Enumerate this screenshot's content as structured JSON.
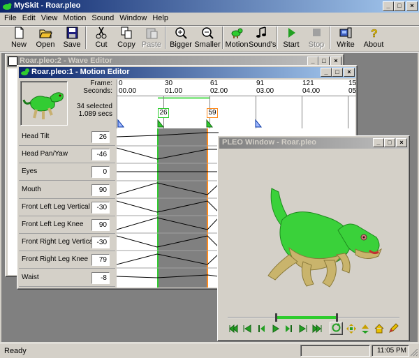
{
  "app": {
    "title": "MySkit - Roar.pleo"
  },
  "menu": [
    "File",
    "Edit",
    "View",
    "Motion",
    "Sound",
    "Window",
    "Help"
  ],
  "toolbar": [
    {
      "label": "New",
      "icon": "new-file-icon",
      "enabled": true
    },
    {
      "label": "Open",
      "icon": "open-folder-icon",
      "enabled": true
    },
    {
      "label": "Save",
      "icon": "save-disk-icon",
      "enabled": true
    },
    {
      "label": "Cut",
      "icon": "scissors-icon",
      "enabled": true
    },
    {
      "label": "Copy",
      "icon": "copy-icon",
      "enabled": true
    },
    {
      "label": "Paste",
      "icon": "paste-icon",
      "enabled": false
    },
    {
      "label": "Bigger",
      "icon": "zoom-in-icon",
      "enabled": true
    },
    {
      "label": "Smaller",
      "icon": "zoom-out-icon",
      "enabled": true
    },
    {
      "label": "Motion",
      "icon": "dinosaur-icon",
      "enabled": true
    },
    {
      "label": "Sound's",
      "icon": "music-note-icon",
      "enabled": true
    },
    {
      "label": "Start",
      "icon": "play-icon",
      "enabled": true
    },
    {
      "label": "Stop",
      "icon": "stop-icon",
      "enabled": false
    },
    {
      "label": "Write",
      "icon": "write-device-icon",
      "enabled": true
    },
    {
      "label": "About",
      "icon": "question-icon",
      "enabled": true
    }
  ],
  "wave_editor": {
    "title": "Roar.pleo:2 - Wave Editor"
  },
  "motion_editor": {
    "title": "Roar.pleo:1 - Motion Editor",
    "frame_label": "Frame:",
    "seconds_label": "Seconds:",
    "selected": "34 selected",
    "duration": "1.089 secs",
    "frames": [
      "0",
      "30",
      "61",
      "91",
      "121",
      "15"
    ],
    "seconds": [
      "00.00",
      "01.00",
      "02.00",
      "03.00",
      "04.00",
      "05"
    ],
    "marker_start": "26",
    "marker_end": "59",
    "joints": [
      {
        "name": "Head Tilt",
        "value": "26"
      },
      {
        "name": "Head Pan/Yaw",
        "value": "-46"
      },
      {
        "name": "Eyes",
        "value": "0"
      },
      {
        "name": "Mouth",
        "value": "90"
      },
      {
        "name": "Front Left Leg Vertical",
        "value": "-30"
      },
      {
        "name": "Front Left Leg Knee",
        "value": "90"
      },
      {
        "name": "Front Right Leg Vertical",
        "value": "-30"
      },
      {
        "name": "Front Right Leg Knee",
        "value": "79"
      },
      {
        "name": "Waist",
        "value": "-8"
      }
    ]
  },
  "pleo_window": {
    "title": "PLEO Window - Roar.pleo",
    "progress": 0.45
  },
  "status": {
    "text": "Ready",
    "time": "11:05 PM"
  },
  "colors": {
    "title_active": "#0a246a",
    "title_inactive": "#808080",
    "dino_green": "#2ecc2e",
    "marker_green": "#2ecc2e",
    "marker_orange": "#ff8a1c"
  }
}
